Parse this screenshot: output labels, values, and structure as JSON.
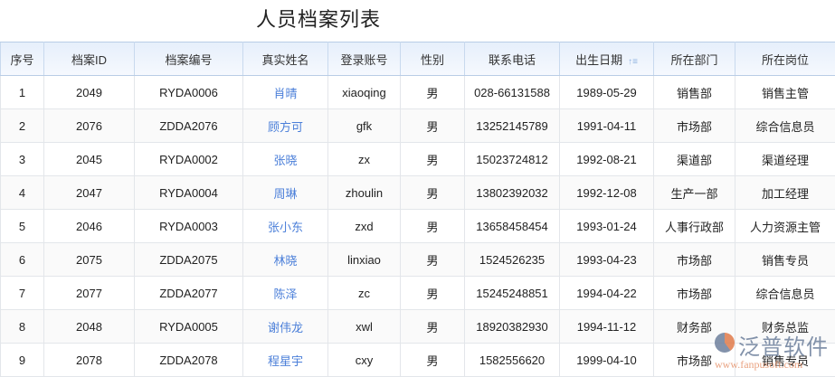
{
  "title": "人员档案列表",
  "columns": [
    "序号",
    "档案ID",
    "档案编号",
    "真实姓名",
    "登录账号",
    "性别",
    "联系电话",
    "出生日期",
    "所在部门",
    "所在岗位"
  ],
  "sort_icon": "sort-ascending-icon",
  "rows": [
    [
      "1",
      "2049",
      "RYDA0006",
      "肖晴",
      "xiaoqing",
      "男",
      "028-66131588",
      "1989-05-29",
      "销售部",
      "销售主管"
    ],
    [
      "2",
      "2076",
      "ZDDA2076",
      "顾方可",
      "gfk",
      "男",
      "13252145789",
      "1991-04-11",
      "市场部",
      "综合信息员"
    ],
    [
      "3",
      "2045",
      "RYDA0002",
      "张晓",
      "zx",
      "男",
      "15023724812",
      "1992-08-21",
      "渠道部",
      "渠道经理"
    ],
    [
      "4",
      "2047",
      "RYDA0004",
      "周琳",
      "zhoulin",
      "男",
      "13802392032",
      "1992-12-08",
      "生产一部",
      "加工经理"
    ],
    [
      "5",
      "2046",
      "RYDA0003",
      "张小东",
      "zxd",
      "男",
      "13658458454",
      "1993-01-24",
      "人事行政部",
      "人力资源主管"
    ],
    [
      "6",
      "2075",
      "ZDDA2075",
      "林晓",
      "linxiao",
      "男",
      "1524526235",
      "1993-04-23",
      "市场部",
      "销售专员"
    ],
    [
      "7",
      "2077",
      "ZDDA2077",
      "陈泽",
      "zc",
      "男",
      "15245248851",
      "1994-04-22",
      "市场部",
      "综合信息员"
    ],
    [
      "8",
      "2048",
      "RYDA0005",
      "谢伟龙",
      "xwl",
      "男",
      "18920382930",
      "1994-11-12",
      "财务部",
      "财务总监"
    ],
    [
      "9",
      "2078",
      "ZDDA2078",
      "程星宇",
      "cxy",
      "男",
      "1582556620",
      "1999-04-10",
      "市场部",
      "销售专员"
    ]
  ],
  "watermark": {
    "name": "泛普软件",
    "url": "www.fanpusoft.com"
  }
}
